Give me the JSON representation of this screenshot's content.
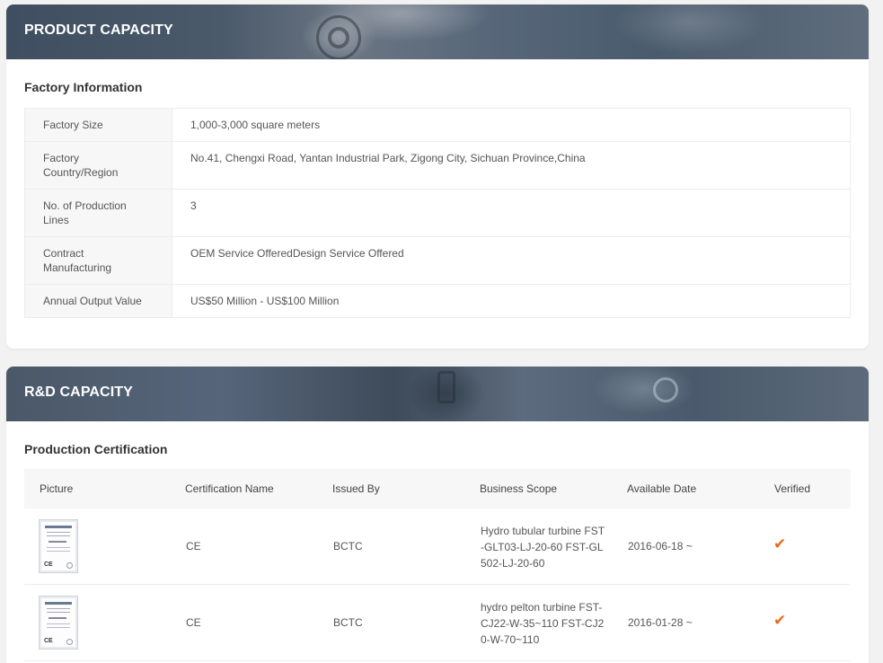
{
  "product_capacity": {
    "title": "PRODUCT CAPACITY",
    "section_title": "Factory Information",
    "rows": [
      {
        "label": "Factory Size",
        "value": "1,000-3,000 square meters"
      },
      {
        "label": "Factory Country/Region",
        "value": "No.41, Chengxi Road, Yantan Industrial Park, Zigong City, Sichuan Province,China"
      },
      {
        "label": "No. of Production Lines",
        "value": "3"
      },
      {
        "label": "Contract Manufacturing",
        "value": "OEM Service OfferedDesign Service Offered"
      },
      {
        "label": "Annual Output Value",
        "value": "US$50 Million - US$100 Million"
      }
    ]
  },
  "rd_capacity": {
    "title": "R&D CAPACITY",
    "section_title": "Production Certification",
    "columns": [
      "Picture",
      "Certification Name",
      "Issued By",
      "Business Scope",
      "Available Date",
      "Verified"
    ],
    "certificates": [
      {
        "name": "CE",
        "issued_by": "BCTC",
        "scope": "Hydro tubular turbine FST-GLT03-LJ-20-60 FST-GL502-LJ-20-60",
        "date": "2016-06-18 ~",
        "verified_icon": "check-icon"
      },
      {
        "name": "CE",
        "issued_by": "BCTC",
        "scope": "hydro pelton turbine FST-CJ22-W-35~110 FST-CJ20-W-70~110",
        "date": "2016-01-28 ~",
        "verified_icon": "check-icon"
      }
    ]
  },
  "colors": {
    "accent": "#f06a1d",
    "banner": "#4b5a6b",
    "label_bg": "#f7f7f7"
  }
}
